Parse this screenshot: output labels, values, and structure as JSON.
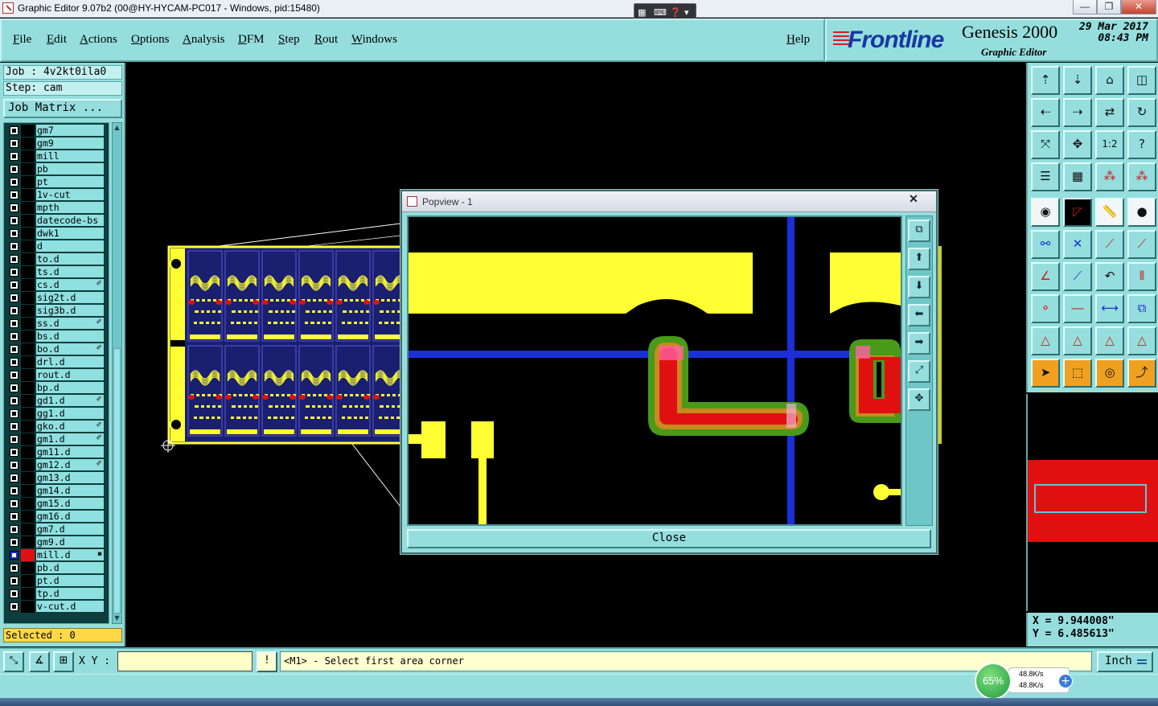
{
  "window": {
    "title": "Graphic Editor 9.07b2 (00@HY-HYCAM-PC017 - Windows, pid:15480)",
    "minimize": "—",
    "maximize": "❐",
    "close": "✕"
  },
  "menu": {
    "items": [
      "File",
      "Edit",
      "Actions",
      "Options",
      "Analysis",
      "DFM",
      "Step",
      "Rout",
      "Windows"
    ],
    "help": "Help"
  },
  "brand": {
    "logo": "Frontline",
    "product": "Genesis 2000",
    "subtitle": "Graphic Editor",
    "date": "29 Mar 2017",
    "time": "08:43 PM"
  },
  "job": {
    "job_label": "Job : 4v2kt0ila0",
    "step_label": "Step: cam",
    "matrix_button": "Job Matrix ..."
  },
  "layers": [
    {
      "name": "gm7",
      "mark": ""
    },
    {
      "name": "gm9",
      "mark": ""
    },
    {
      "name": "mill",
      "mark": ""
    },
    {
      "name": "pb",
      "mark": ""
    },
    {
      "name": "pt",
      "mark": ""
    },
    {
      "name": "1v-cut",
      "mark": ""
    },
    {
      "name": "mpth",
      "mark": ""
    },
    {
      "name": "datecode-bs",
      "mark": ""
    },
    {
      "name": "dwk1",
      "mark": ""
    },
    {
      "name": "d",
      "mark": ""
    },
    {
      "name": "to.d",
      "mark": ""
    },
    {
      "name": "ts.d",
      "mark": ""
    },
    {
      "name": "cs.d",
      "mark": "✐"
    },
    {
      "name": "sig2t.d",
      "mark": ""
    },
    {
      "name": "sig3b.d",
      "mark": ""
    },
    {
      "name": "ss.d",
      "mark": "✐"
    },
    {
      "name": "bs.d",
      "mark": ""
    },
    {
      "name": "bo.d",
      "mark": "✐"
    },
    {
      "name": "drl.d",
      "mark": ""
    },
    {
      "name": "rout.d",
      "mark": ""
    },
    {
      "name": "bp.d",
      "mark": ""
    },
    {
      "name": "gd1.d",
      "mark": "✐"
    },
    {
      "name": "gg1.d",
      "mark": ""
    },
    {
      "name": "gko.d",
      "mark": "✐"
    },
    {
      "name": "gm1.d",
      "mark": "✐"
    },
    {
      "name": "gm11.d",
      "mark": ""
    },
    {
      "name": "gm12.d",
      "mark": "✐"
    },
    {
      "name": "gm13.d",
      "mark": ""
    },
    {
      "name": "gm14.d",
      "mark": ""
    },
    {
      "name": "gm15.d",
      "mark": ""
    },
    {
      "name": "gm16.d",
      "mark": ""
    },
    {
      "name": "gm7.d",
      "mark": ""
    },
    {
      "name": "gm9.d",
      "mark": ""
    },
    {
      "name": "mill.d",
      "mark": "▪",
      "active": true
    },
    {
      "name": "pb.d",
      "mark": ""
    },
    {
      "name": "pt.d",
      "mark": ""
    },
    {
      "name": "tp.d",
      "mark": ""
    },
    {
      "name": "v-cut.d",
      "mark": ""
    }
  ],
  "selected": "Selected : 0",
  "popview": {
    "title": "Popview - 1",
    "close_x": "✕",
    "close_button": "Close"
  },
  "coords": {
    "x": "X = 9.944008\"",
    "y": "Y = 6.485613\""
  },
  "bottom": {
    "xy_label": "X Y :",
    "xy_value": "",
    "alert": "!",
    "prompt": "<M1> - Select first area corner",
    "unit": "Inch"
  },
  "netmeter": {
    "percent": "65%",
    "up": "48.8K/s",
    "down": "48.8K/s",
    "plus": "+"
  },
  "colors": {
    "panel": "#96dede",
    "copper": "#ffff33",
    "rout": "#1a2fd8",
    "highlight": "#e01010"
  }
}
